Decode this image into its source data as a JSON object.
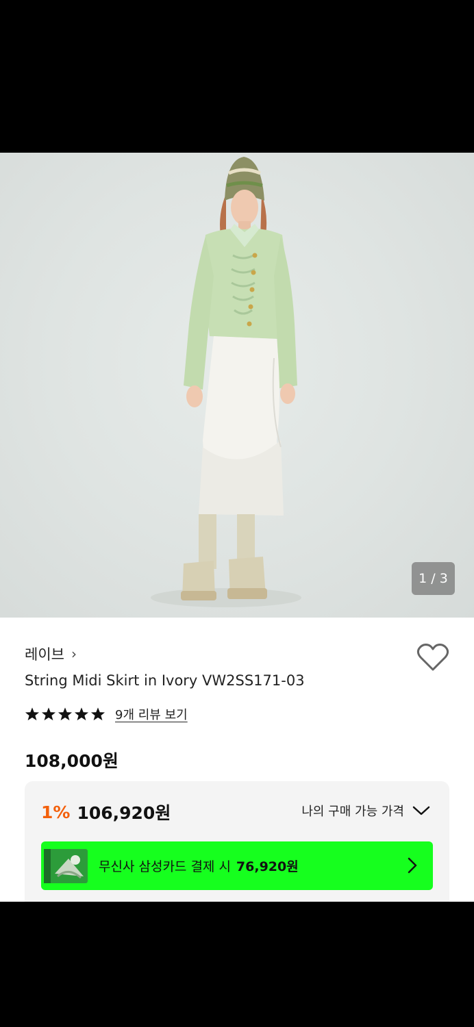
{
  "gallery": {
    "counter": "1 / 3"
  },
  "product": {
    "brand": "레이브",
    "brand_chevron": "›",
    "title": "String Midi Skirt in Ivory VW2SS171-03",
    "rating_stars": 5,
    "review_link": "9개 리뷰 보기",
    "price": "108,000원"
  },
  "price_box": {
    "discount_percent": "1%",
    "discount_price": "106,920원",
    "my_price_label": "나의 구매 가능 가격",
    "card_offer_label": "무신사 삼성카드 결제 시",
    "card_offer_price": "76,920원"
  },
  "colors": {
    "discount": "#f3600c",
    "card_banner": "#16ff1e"
  }
}
